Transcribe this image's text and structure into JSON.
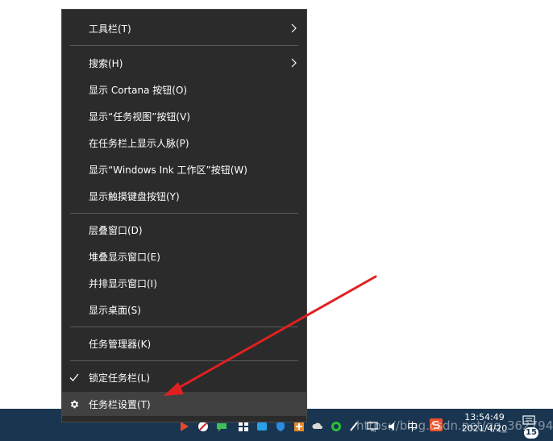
{
  "menu": {
    "items": [
      {
        "label": "工具栏(T)"
      },
      {
        "label": "搜索(H)"
      },
      {
        "label": "显示 Cortana 按钮(O)"
      },
      {
        "label": "显示“任务视图”按钮(V)"
      },
      {
        "label": "在任务栏上显示人脉(P)"
      },
      {
        "label": "显示“Windows Ink 工作区”按钮(W)"
      },
      {
        "label": "显示触摸键盘按钮(Y)"
      },
      {
        "label": "层叠窗口(D)"
      },
      {
        "label": "堆叠显示窗口(E)"
      },
      {
        "label": "并排显示窗口(I)"
      },
      {
        "label": "显示桌面(S)"
      },
      {
        "label": "任务管理器(K)"
      },
      {
        "label": "锁定任务栏(L)"
      },
      {
        "label": "任务栏设置(T)"
      }
    ]
  },
  "taskbar": {
    "time": "13:54:49",
    "date": "2021/4/20",
    "ime": "中",
    "notification_count": "15",
    "watermark": "https://blog.csdn.net/qq_36279445"
  },
  "colors": {
    "menu_bg": "#2b2b2b",
    "menu_highlight": "#414141",
    "taskbar_bg": "#1a3550",
    "annotation_arrow": "#e02020"
  }
}
